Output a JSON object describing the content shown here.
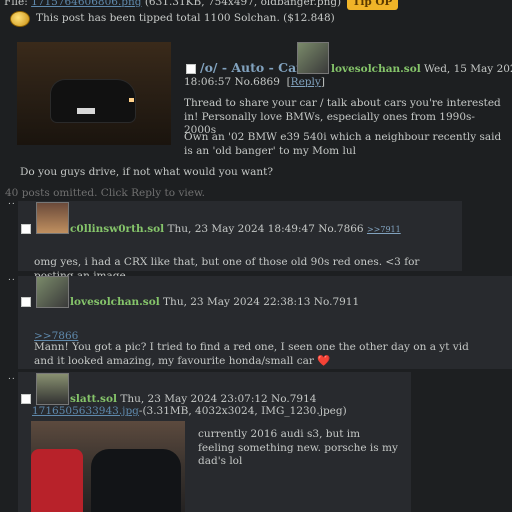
{
  "op": {
    "file_link": "1715764606806.png",
    "file_prefix": "File: ",
    "file_meta": " (631.31KB, 754x497, oldbanger.png)",
    "tip_badge": "Tip OP",
    "tip_message": "This post has been tipped total 1100 Solchan. ($12.848)",
    "subject": "/o/ - Auto - Cars!",
    "name": "lovesolchan.sol",
    "date": "Wed, 15 May 2024",
    "time_no": "18:06:57 No.6869",
    "reply_label": "Reply",
    "body_1": "Thread to share your car / talk about cars you're interested in! Personally love BMWs, especially ones from 1990s-2000s",
    "body_2": "Own an '02 BMW e39 540i which a neighbour recently said is an 'old banger' to my Mom lul",
    "body_3": "Do you guys drive, if not what would you want?",
    "omitted": "40 posts omitted. Click Reply to view."
  },
  "replies": [
    {
      "dots": "..",
      "name": "c0llinsw0rth.sol",
      "date_no": "Thu, 23 May 2024 18:49:47 No.7866",
      "backlink": ">>7911",
      "body": "omg yes, i had a CRX like that, but one of those old 90s red ones. <3 for posting an image"
    },
    {
      "dots": "..",
      "name": "lovesolchan.sol",
      "date_no": "Thu, 23 May 2024 22:38:13 No.7911",
      "quote": ">>7866",
      "body": "Mann! You got a pic? I tried to find a red one, I seen one the other day on a yt vid and it looked amazing, my favourite honda/small car",
      "heart": "❤️"
    },
    {
      "dots": "..",
      "name": "slatt.sol",
      "date_no": "Thu, 23 May 2024 23:07:12 No.7914",
      "file_link": "1716505633943.jpg",
      "file_meta": "-(3.31MB, 4032x3024, IMG_1230.jpeg)",
      "body": "currently 2016 audi s3, but im feeling something new. porsche is my dad's lol"
    }
  ],
  "colors": {
    "background": "#1d1f21",
    "reply_bg": "#282a2e",
    "name": "#85c46a",
    "subject": "#81a2be",
    "link": "#5f89ac",
    "tip_badge": "#f0b428",
    "heart": "#e0294a"
  },
  "icons": [
    "coin-icon",
    "checkbox",
    "heart-icon"
  ]
}
